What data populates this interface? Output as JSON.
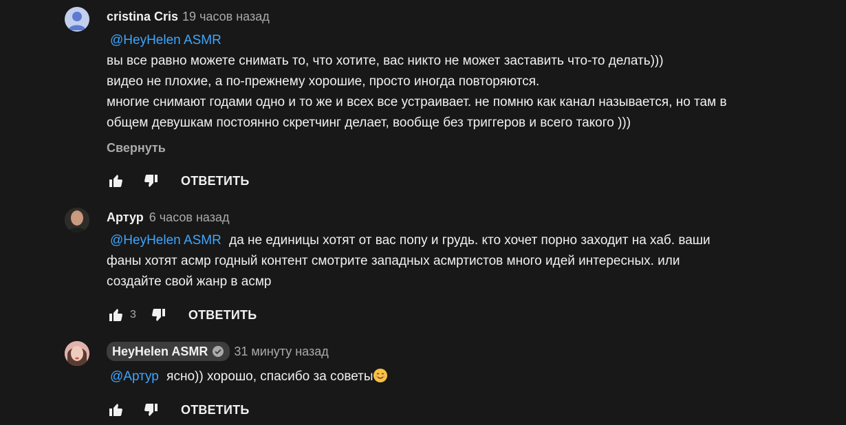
{
  "comments": [
    {
      "author": "cristina Cris",
      "time": "19 часов назад",
      "mention": "@HeyHelen ASMR",
      "lines": [
        "вы все равно можете снимать то, что хотите, вас никто не может заставить что-то делать)))",
        "видео не плохие, а по-прежнему хорошие, просто иногда повторяются.",
        "многие снимают годами одно и то же и всех все устраивает. не помню как канал называется, но там в",
        "общем девушкам постоянно скретчинг делает, вообще без триггеров и всего такого )))"
      ],
      "collapse_label": "Свернуть",
      "like_count": "",
      "reply_label": "ОТВЕТИТЬ"
    },
    {
      "author": "Артур",
      "time": "6 часов назад",
      "mention": "@HeyHelen ASMR",
      "first_line_rest": "да не единицы хотят от вас попу и грудь. кто хочет порно заходит на хаб. ваши",
      "lines": [
        "фаны хотят асмр годный контент смотрите западных асмртистов много идей интересных. или",
        "создайте свой жанр в асмр"
      ],
      "like_count": "3",
      "reply_label": "ОТВЕТИТЬ"
    },
    {
      "author": "HeyHelen ASMR",
      "verified": true,
      "time": "31 минуту назад",
      "mention": "@Артур",
      "text": "ясно)) хорошо, спасибо за советы",
      "emoji_icon": "smiling-face-icon",
      "like_count": "",
      "reply_label": "ОТВЕТИТЬ"
    }
  ],
  "colors": {
    "background": "#181818",
    "text": "#f1f1f1",
    "secondary": "#aaaaaa",
    "link": "#3ea6ff",
    "badge": "#3d3d3d"
  }
}
